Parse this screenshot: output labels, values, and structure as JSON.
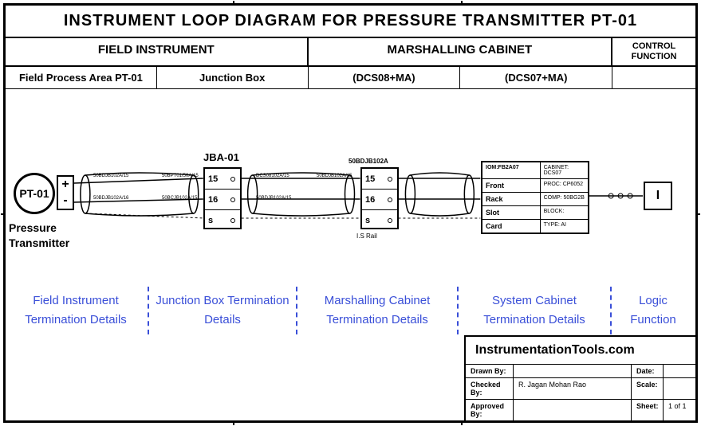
{
  "title": "INSTRUMENT LOOP DIAGRAM FOR PRESSURE TRANSMITTER PT-01",
  "headers": {
    "field": "FIELD INSTRUMENT",
    "marshalling": "MARSHALLING CABINET",
    "control": "CONTROL FUNCTION"
  },
  "subheaders": {
    "field_area": "Field Process Area PT-01",
    "junction": "Junction Box",
    "dcs08": "(DCS08+MA)",
    "dcs07": "(DCS07+MA)",
    "empty": ""
  },
  "transmitter": {
    "tag": "PT-01",
    "plus": "+",
    "minus": "-",
    "label": "Pressure\nTransmitter"
  },
  "junction_box": {
    "label": "JBA-01",
    "terminals": [
      "15",
      "16",
      "s"
    ]
  },
  "marshalling_box": {
    "label": "50BDJB102A",
    "terminals": [
      "15",
      "16",
      "s"
    ],
    "sub": "I.S Rail"
  },
  "system_cabinet": {
    "rows": [
      {
        "c1": "IOM:FB2A07",
        "c2": "CABINET: DCS07"
      },
      {
        "c1": "Front",
        "c2": "PROC: CP6052"
      },
      {
        "c1": "Rack",
        "c2": "COMP: 50BG2B"
      },
      {
        "c1": "Slot",
        "c2": "BLOCK:"
      },
      {
        "c1": "Card",
        "c2": "TYPE: AI"
      }
    ]
  },
  "logic": "I",
  "blue_labels": {
    "field": "Field Instrument Termination Details",
    "junction": "Junction Box Termination Details",
    "marshalling": "Marshalling Cabinet Termination Details",
    "system": "System Cabinet Termination Details",
    "logic": "Logic Function"
  },
  "title_block": {
    "site": "InstrumentationTools.com",
    "rows": [
      {
        "lab": "Drawn By:",
        "val": "",
        "rlab": "Date:",
        "rval": ""
      },
      {
        "lab": "Checked By:",
        "val": "R. Jagan Mohan Rao",
        "rlab": "Scale:",
        "rval": ""
      },
      {
        "lab": "Approved By:",
        "val": "",
        "rlab": "Sheet:",
        "rval": "1 of 1"
      }
    ]
  }
}
